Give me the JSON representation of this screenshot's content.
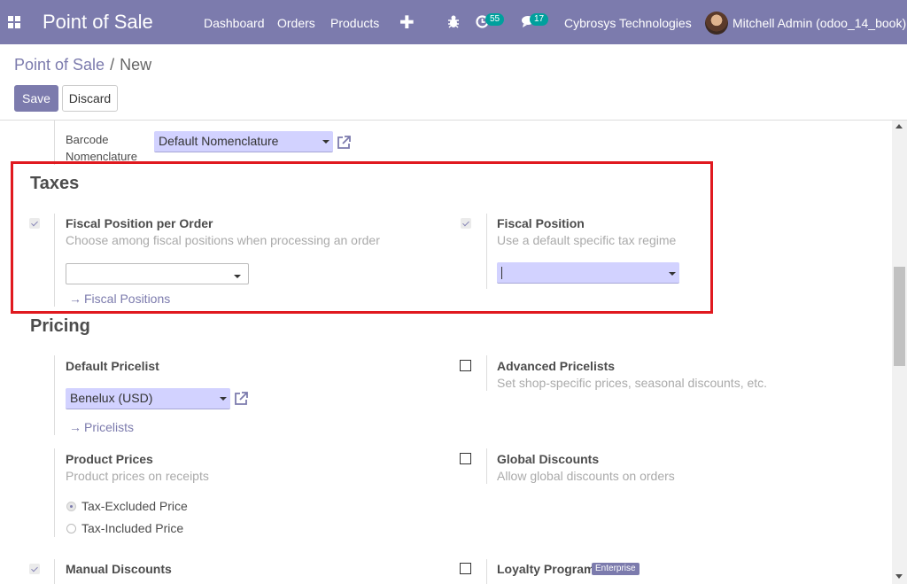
{
  "navbar": {
    "app_title": "Point of Sale",
    "menu": [
      "Dashboard",
      "Orders",
      "Products"
    ],
    "activity_count": "55",
    "message_count": "17",
    "company": "Cybrosys Technologies",
    "user": "Mitchell Admin (odoo_14_book)"
  },
  "breadcrumb": {
    "parent": "Point of Sale",
    "separator": "/",
    "current": "New"
  },
  "buttons": {
    "save": "Save",
    "discard": "Discard"
  },
  "barcode": {
    "label_line1": "Barcode",
    "label_line2": "Nomenclature",
    "value": "Default Nomenclature"
  },
  "taxes": {
    "title": "Taxes",
    "fiscal_per_order": {
      "label": "Fiscal Position per Order",
      "help": "Choose among fiscal positions when processing an order",
      "checked": true,
      "value": "",
      "link": "Fiscal Positions"
    },
    "fiscal_position": {
      "label": "Fiscal Position",
      "help": "Use a default specific tax regime",
      "checked": true,
      "value": ""
    }
  },
  "pricing": {
    "title": "Pricing",
    "default_pricelist": {
      "label": "Default Pricelist",
      "value": "Benelux (USD)",
      "link": "Pricelists"
    },
    "advanced_pricelists": {
      "label": "Advanced Pricelists",
      "help": "Set shop-specific prices, seasonal discounts, etc.",
      "checked": false
    },
    "product_prices": {
      "label": "Product Prices",
      "help": "Product prices on receipts",
      "options": [
        "Tax-Excluded Price",
        "Tax-Included Price"
      ],
      "selected": "Tax-Excluded Price"
    },
    "global_discounts": {
      "label": "Global Discounts",
      "help": "Allow global discounts on orders",
      "checked": false
    },
    "manual_discounts": {
      "label": "Manual Discounts",
      "checked": true
    },
    "loyalty_program": {
      "label": "Loyalty Program",
      "badge": "Enterprise",
      "checked": false
    }
  },
  "colors": {
    "brand": "#7c7bad",
    "highlight": "#e0191f",
    "select_fill": "#d2d2ff",
    "badge": "#00a09d"
  }
}
